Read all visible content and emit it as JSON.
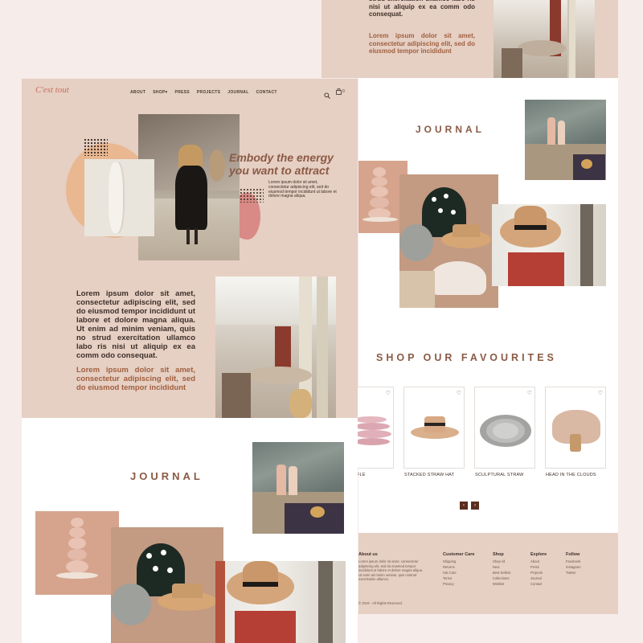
{
  "brand": {
    "logo": "C'est tout"
  },
  "nav": {
    "items": [
      "ABOUT",
      "SHOP",
      "PRESS",
      "PROJECTS",
      "JOURNAL",
      "CONTACT"
    ],
    "cart_count": "0"
  },
  "hero": {
    "headline_1": "Embody the energy",
    "headline_2": "you want to attract",
    "blurb": "Lorem ipsum dolor sit amet, consectetur adipiscing elit, sed do eiusmod tempor incididunt ut labore et dolore magna aliqua."
  },
  "intro": {
    "paragraph": "Lorem ipsum dolor sit amet, consectetur adipiscing elit, sed do eiusmod tempor incididunt ut labore et dolore magna aliqua. Ut enim ad minim veniam, quis no strud exercitation ullamco labo ris nisi ut aliquip ex ea comm odo consequat.",
    "accent": "Lorem ipsum dolor sit amet, consectetur adipiscing elit, sed do eiusmod tempor incididunt"
  },
  "top_right": {
    "paragraph_tail": "strud exercitation ullamco labo ris nisi ut aliquip ex ea comm odo consequat.",
    "accent": "Lorem ipsum dolor sit amet, consectetur adipiscing elit, sed do eiusmod tempor incididunt"
  },
  "journal": {
    "title": "JOURNAL"
  },
  "shop": {
    "title": "SHOP OUR FAVOURITES",
    "products": [
      "FLÉ",
      "STACKED STRAW HAT",
      "SCULPTURAL STRAW",
      "HEAD IN THE CLOUDS"
    ]
  },
  "footer": {
    "about_title": "About us",
    "about_text": "Lorem ipsum dolor sit amet, consectetur adipiscing elit, sed do eiusmod tempor incididunt ut labore et dolore magna aliqua. Ut enim ad minim veniam, quis nostrud exercitation ullamco.",
    "columns": [
      {
        "title": "Customer Care",
        "items": [
          "Shipping",
          "Returns",
          "Hat Care",
          "Terms",
          "Privacy"
        ]
      },
      {
        "title": "Shop",
        "items": [
          "Shop All",
          "New",
          "Best Sellers",
          "Collections",
          "Wishlist"
        ]
      },
      {
        "title": "Explore",
        "items": [
          "About",
          "Press",
          "Projects",
          "Journal",
          "Contact"
        ]
      },
      {
        "title": "Follow",
        "items": [
          "Facebook",
          "Instagram",
          "Twitter"
        ]
      }
    ],
    "copyright": "© 2019 · All Rights Reserved"
  },
  "colors": {
    "beige": "#e6cfc3",
    "accent": "#8a5a44",
    "rose": "#d98a86"
  }
}
